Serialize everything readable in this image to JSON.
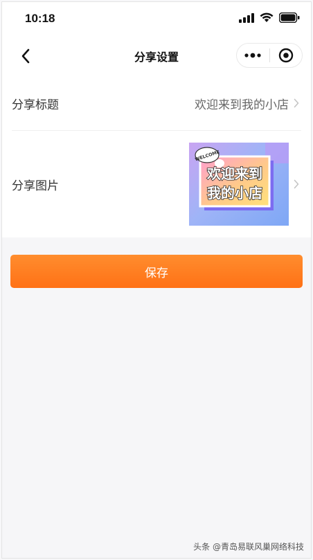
{
  "status_bar": {
    "time": "10:18"
  },
  "nav": {
    "title": "分享设置",
    "back_icon": "chevron-left-icon",
    "menu_icon": "more-dots-icon",
    "close_icon": "target-close-icon"
  },
  "settings": {
    "share_title": {
      "label": "分享标题",
      "value": "欢迎来到我的小店"
    },
    "share_image": {
      "label": "分享图片",
      "image_badge": "WELCOME",
      "image_line1": "欢迎来到",
      "image_line2": "我的小店"
    }
  },
  "actions": {
    "save_label": "保存"
  },
  "watermark": "头条 @青岛易联风巢网络科技",
  "colors": {
    "accent": "#ff7a1f",
    "background": "#f6f6f8"
  }
}
